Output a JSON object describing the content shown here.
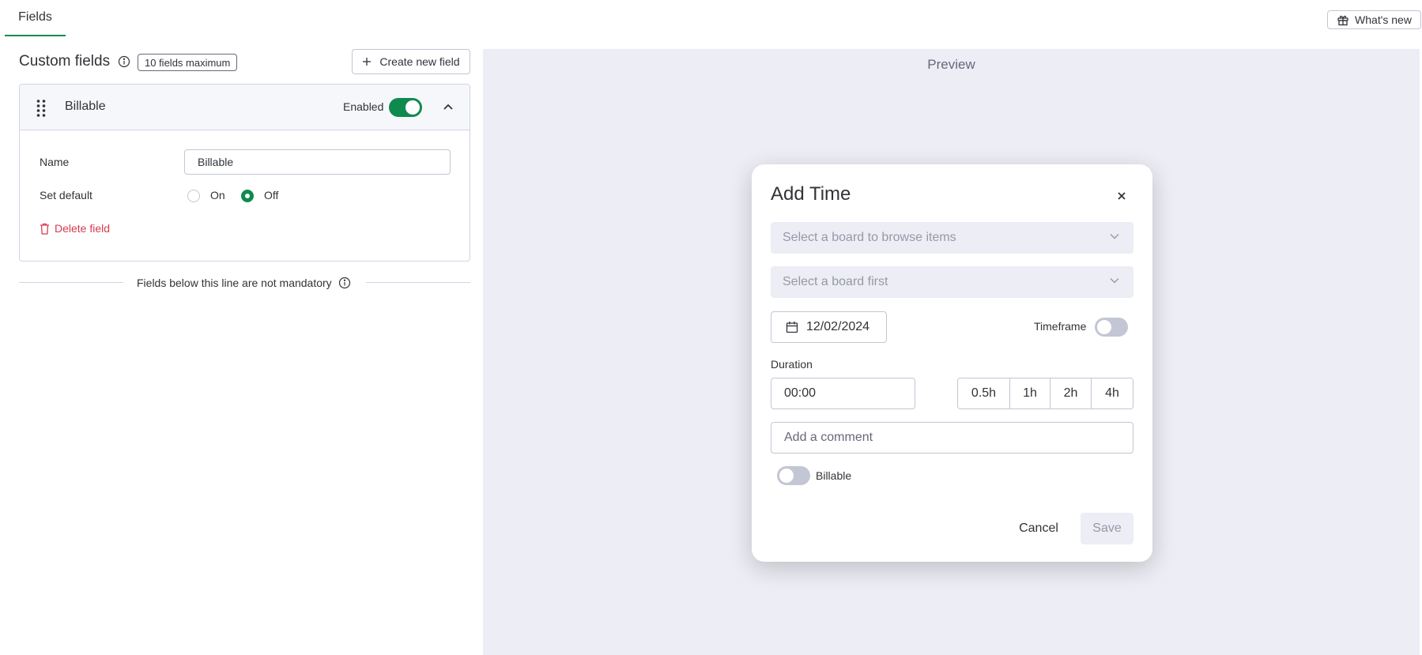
{
  "header": {
    "tab_label": "Fields",
    "whats_new_label": "What's new"
  },
  "custom_fields": {
    "title": "Custom fields",
    "max_badge": "10 fields maximum",
    "create_button": "Create new field",
    "field": {
      "name": "Billable",
      "enabled_label": "Enabled",
      "enabled": true,
      "name_label": "Name",
      "name_value": "Billable",
      "default_label": "Set default",
      "default_options": [
        "On",
        "Off"
      ],
      "default_selected": "Off",
      "delete_label": "Delete field"
    },
    "divider_text": "Fields below this line are not mandatory"
  },
  "preview": {
    "title": "Preview",
    "modal": {
      "title": "Add Time",
      "board_placeholder": "Select a board to browse items",
      "item_placeholder": "Select a board first",
      "date": "12/02/2024",
      "timeframe_label": "Timeframe",
      "duration_label": "Duration",
      "duration_value": "00:00",
      "quick_durations": [
        "0.5h",
        "1h",
        "2h",
        "4h"
      ],
      "comment_placeholder": "Add a comment",
      "billable_label": "Billable",
      "cancel_label": "Cancel",
      "save_label": "Save"
    }
  },
  "colors": {
    "accent_green": "#0f8a4f",
    "danger_red": "#d83a52",
    "preview_bg": "#ededf5"
  }
}
